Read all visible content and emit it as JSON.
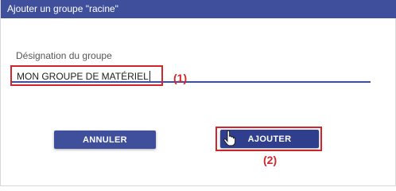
{
  "dialog": {
    "title": "Ajouter un groupe \"racine\""
  },
  "form": {
    "label": "Désignation du groupe",
    "value": "MON GROUPE DE MATÉRIEL"
  },
  "annotations": {
    "input": "(1)",
    "button": "(2)"
  },
  "buttons": {
    "cancel": "ANNULER",
    "add": "AJOUTER"
  },
  "colors": {
    "accent": "#3f4f9b",
    "highlight": "#d0262c"
  },
  "icons": {
    "cursor": "hand-pointer-icon"
  }
}
